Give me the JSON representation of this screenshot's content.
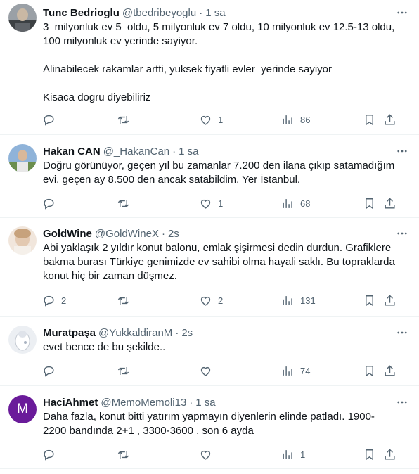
{
  "tweets": [
    {
      "name": "Tunc Bedrioglu",
      "handle": "@tbedribeyoglu",
      "time": "1 sa",
      "text": "3  milyonluk ev 5  oldu, 5 milyonluk ev 7 oldu, 10 milyonluk ev 12.5-13 oldu,\n100 milyonluk ev yerinde sayiyor.\n\nAlinabilecek rakamlar artti, yuksek fiyatli evler  yerinde sayiyor\n\nKisaca dogru diyebiliriz",
      "replies": "",
      "retweets": "",
      "likes": "1",
      "views": "86"
    },
    {
      "name": "Hakan CAN",
      "handle": "@_HakanCan",
      "time": "1 sa",
      "text": "Doğru görünüyor, geçen yıl bu zamanlar 7.200 den ilana çıkıp satamadığım\nevi, geçen ay 8.500 den ancak satabildim. Yer İstanbul.",
      "replies": "",
      "retweets": "",
      "likes": "1",
      "views": "68"
    },
    {
      "name": "GoldWine",
      "handle": "@GoldWineX",
      "time": "2s",
      "text": "Abi yaklaşık 2 yıldır konut balonu, emlak şişirmesi dedin durdun. Grafiklere\nbakma burası Türkiye genimizde ev sahibi olma hayali saklı. Bu topraklarda\nkonut hiç bir zaman düşmez.",
      "replies": "2",
      "retweets": "",
      "likes": "2",
      "views": "131"
    },
    {
      "name": "Muratpaşa",
      "handle": "@YukkaldiranM",
      "time": "2s",
      "text": "evet bence de bu şekilde..",
      "replies": "",
      "retweets": "",
      "likes": "",
      "views": "74"
    },
    {
      "name": "HaciAhmet",
      "handle": "@MemoMemoli13",
      "time": "1 sa",
      "avatar_letter": "M",
      "text": "Daha fazla, konut bitti yatırım yapmayın diyenlerin elinde patladı. 1900-\n2200 bandında 2+1 , 3300-3600 , son 6 ayda",
      "replies": "",
      "retweets": "",
      "likes": "",
      "views": "1"
    }
  ],
  "colors": {
    "text_primary": "#0f1419",
    "text_secondary": "#536471",
    "divider": "#eff3f4",
    "avatar_m": "#6a1b9a"
  },
  "icons": [
    "more-icon",
    "reply-icon",
    "retweet-icon",
    "like-icon",
    "views-icon",
    "bookmark-icon",
    "share-icon"
  ]
}
